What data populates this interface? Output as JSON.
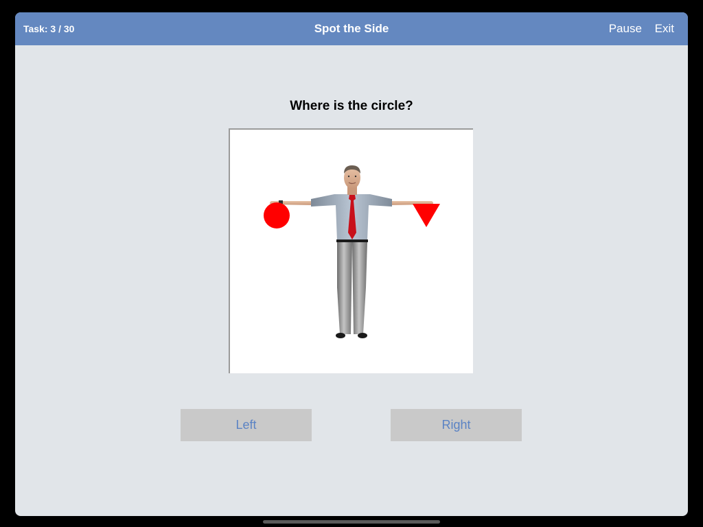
{
  "header": {
    "task_counter": "Task: 3 / 30",
    "title": "Spot the Side",
    "pause_label": "Pause",
    "exit_label": "Exit"
  },
  "question": "Where is the circle?",
  "stimulus": {
    "figure": "standing-man-t-pose",
    "shapes": [
      {
        "shape": "circle",
        "side_in_image": "left",
        "color": "#ff0000"
      },
      {
        "shape": "triangle",
        "side_in_image": "right",
        "color": "#ff0000"
      }
    ]
  },
  "answers": {
    "left_label": "Left",
    "right_label": "Right"
  },
  "colors": {
    "header_bg": "#6488c0",
    "app_bg": "#e1e5e9",
    "button_bg": "#c9c9c9",
    "button_text": "#5b83c4",
    "shape_red": "#ff0000"
  }
}
